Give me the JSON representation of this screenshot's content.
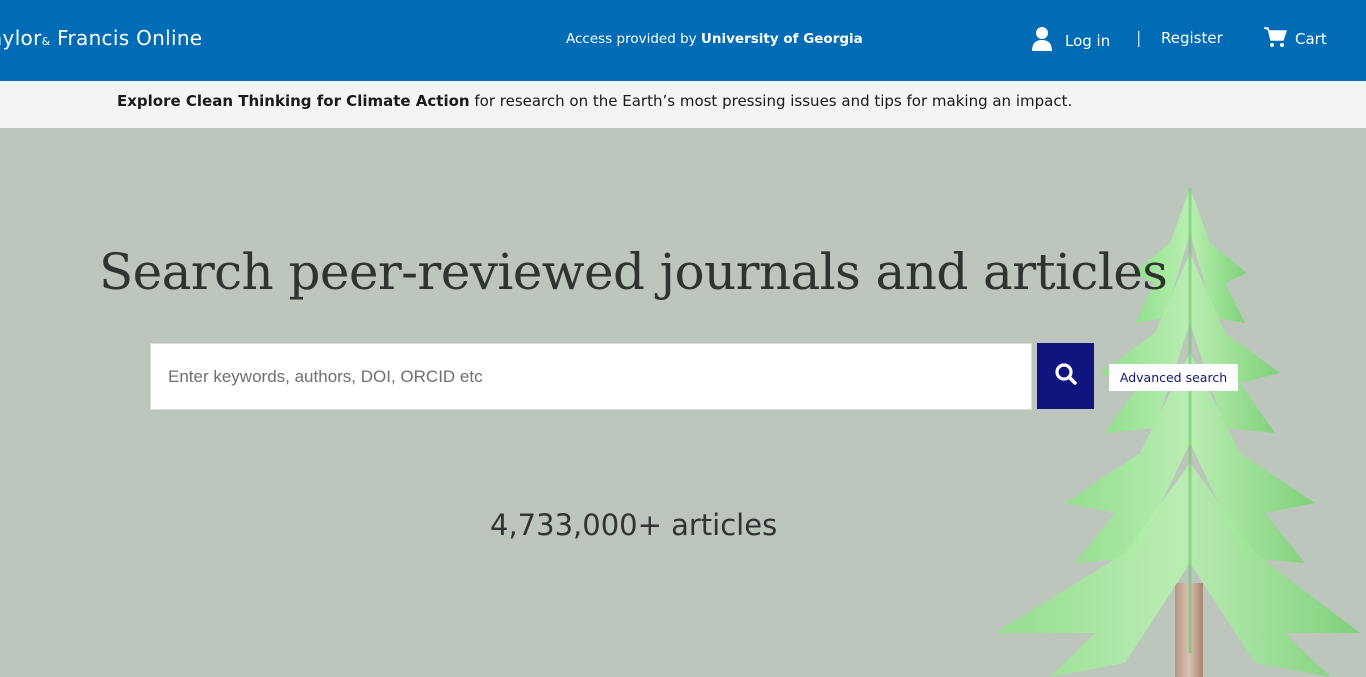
{
  "header": {
    "logo_main": "aylor",
    "logo_amp": "&",
    "logo_rest": " Francis Online",
    "access_prefix": "Access provided by ",
    "access_institution": "University of Georgia",
    "login_label": "Log in",
    "separator": "|",
    "register_label": "Register",
    "cart_label": "Cart"
  },
  "banner": {
    "link_text": "Explore Clean Thinking for Climate Action",
    "rest_text": " for research on the Earth’s most pressing issues and tips for making an impact."
  },
  "hero": {
    "title": "Search peer-reviewed journals and articles",
    "search_placeholder": "Enter keywords, authors, DOI, ORCID etc",
    "advanced_search_label": "Advanced search",
    "article_count": "4,733,000+ articles"
  },
  "icons": {
    "user": "user-icon",
    "cart": "cart-icon",
    "search": "search-icon",
    "tree": "tree-illustration"
  },
  "colors": {
    "brand_blue": "#006cb6",
    "search_button": "#10147e",
    "hero_background": "#bcc6bd"
  }
}
